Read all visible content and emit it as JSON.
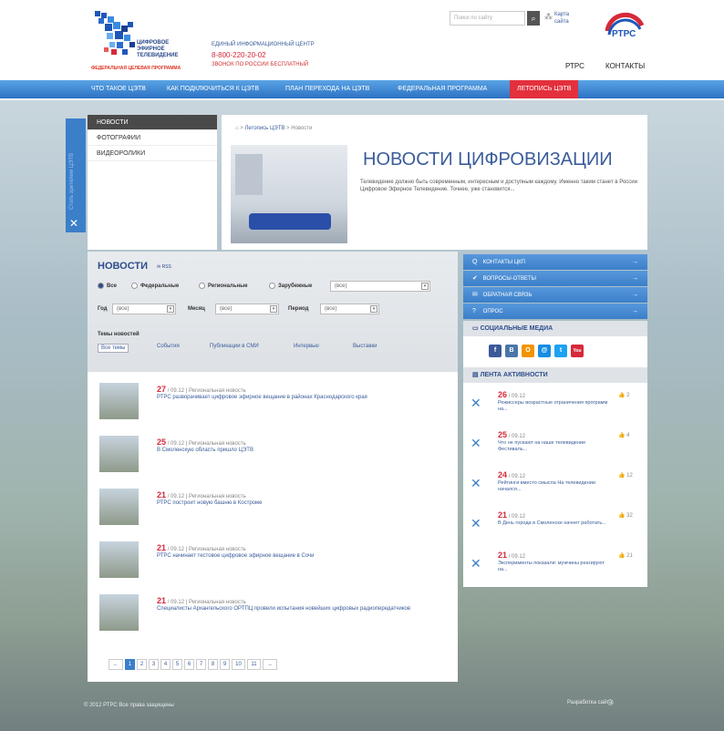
{
  "logo": {
    "line1": "ЦИФРОВОЕ",
    "line2": "ЭФИРНОЕ",
    "line3": "ТЕЛЕВИДЕНИЕ",
    "sub": "ФЕДЕРАЛЬНАЯ ЦЕЛЕВАЯ ПРОГРАММА"
  },
  "info": {
    "line1": "ЕДИНЫЙ ИНФОРМАЦИОННЫЙ ЦЕНТР",
    "phone": "8-800-220-20-02",
    "line3": "ЗВОНОК ПО РОССИИ БЕСПЛАТНЫЙ"
  },
  "search": {
    "placeholder": "Поиск по сайту"
  },
  "sitemap": {
    "line1": "Карта",
    "line2": "сайта"
  },
  "rtrs": {
    "logo_text": "РТРС",
    "sub": "РОССИЙСКАЯ ТЕЛЕВИЗИОННАЯ И РАДИОВЕЩАТЕЛЬНАЯ СЕТЬ"
  },
  "toplinks": [
    "РТРС",
    "КОНТАКТЫ"
  ],
  "nav": [
    "ЧТО ТАКОЕ ЦЭТВ",
    "КАК ПОДКЛЮЧИТЬСЯ К ЦЭТВ",
    "ПЛАН ПЕРЕХОДА НА ЦЭТВ",
    "ФЕДЕРАЛЬНАЯ ПРОГРАММА",
    "ЛЕТОПИСЬ ЦЭТВ"
  ],
  "side_tab": "Стать зрителем ЦЭТВ",
  "leftnav": [
    "НОВОСТИ",
    "ФОТОГРАФИИ",
    "ВИДЕОРОЛИКИ"
  ],
  "crumbs": {
    "section": "Летопись ЦЭТВ",
    "current": "Новости"
  },
  "hero": {
    "title": "НОВОСТИ ЦИФРОВИЗАЦИИ",
    "desc": "Телевидение должно быть современным, интересным и доступным каждому. Именно таким станет в России Цифровое Эфирное Телевидение. Точнее, уже становится..."
  },
  "filters": {
    "title": "НОВОСТИ",
    "rss": "RSS",
    "radios": [
      "Все",
      "Федеральные",
      "Региональные",
      "Зарубежные"
    ],
    "region_select": "(все)",
    "year_label": "Год",
    "year": "(все)",
    "month_label": "Месяц",
    "month": "(все)",
    "period_label": "Период",
    "period": "(все)",
    "topics_title": "Темы новостей",
    "topics": [
      "Все темы",
      "События",
      "Публикации в СМИ",
      "Интервью",
      "Выставки"
    ]
  },
  "news": [
    {
      "day": "27",
      "date": "/ 09.12",
      "cat": "Региональная новость",
      "title": "РТРС разворачивает цифровое эфирное вещание в районах Краснодарского края"
    },
    {
      "day": "25",
      "date": "/ 09.12",
      "cat": "Региональная новость",
      "title": "В Смоленскую область пришло ЦЭТВ"
    },
    {
      "day": "21",
      "date": "/ 09.12",
      "cat": "Региональная новость",
      "title": "РТРС построит новую башню в Костроме"
    },
    {
      "day": "21",
      "date": "/ 09.12",
      "cat": "Региональная новость",
      "title": "РТРС начинает тестовое цифровое эфирное вещание в Сочи"
    },
    {
      "day": "21",
      "date": "/ 09.12",
      "cat": "Региональная новость",
      "title": "Специалисты Архангельского ОРТПЦ провели испытания новейших цифровых радиопередатчиков"
    }
  ],
  "pager": [
    "←",
    "1",
    "2",
    "3",
    "4",
    "5",
    "6",
    "7",
    "8",
    "9",
    "10",
    "11",
    "→"
  ],
  "right_buttons": [
    {
      "label": "КОНТАКТЫ ЦКП",
      "icon": "Q"
    },
    {
      "label": "ВОПРОСЫ-ОТВЕТЫ",
      "icon": "✔"
    },
    {
      "label": "ОБРАТНАЯ СВЯЗЬ",
      "icon": "✉"
    },
    {
      "label": "ОПРОС",
      "icon": "?"
    }
  ],
  "social_title": "СОЦИАЛЬНЫЕ МЕДИА",
  "social": [
    {
      "label": "f",
      "color": "#3b5998"
    },
    {
      "label": "B",
      "color": "#4a76a8"
    },
    {
      "label": "О",
      "color": "#f29400"
    },
    {
      "label": "@",
      "color": "#168de2"
    },
    {
      "label": "t",
      "color": "#1da1f2"
    },
    {
      "label": "You",
      "color": "#d6293a"
    }
  ],
  "activity_title": "ЛЕНТА АКТИВНОСТИ",
  "activity": [
    {
      "day": "26",
      "date": "/ 09.12",
      "text": "Режиссеры возрастные ограничения программ на...",
      "likes": "2"
    },
    {
      "day": "25",
      "date": "/ 09.12",
      "text": "Что не пускают на наше телевидение Фестиваль...",
      "likes": "4"
    },
    {
      "day": "24",
      "date": "/ 09.12",
      "text": "Рейтинги вместо смысла На телевидении начался...",
      "likes": "12"
    },
    {
      "day": "21",
      "date": "/ 09.12",
      "text": "В День города в Смоленске начнет работать...",
      "likes": "32"
    },
    {
      "day": "21",
      "date": "/ 09.12",
      "text": "Эксперименты показали: мужчины реагируют на...",
      "likes": "21"
    }
  ],
  "footer": {
    "copyright": "© 2012 РТРС Все права защищены",
    "dev": "Разработка сайта"
  }
}
